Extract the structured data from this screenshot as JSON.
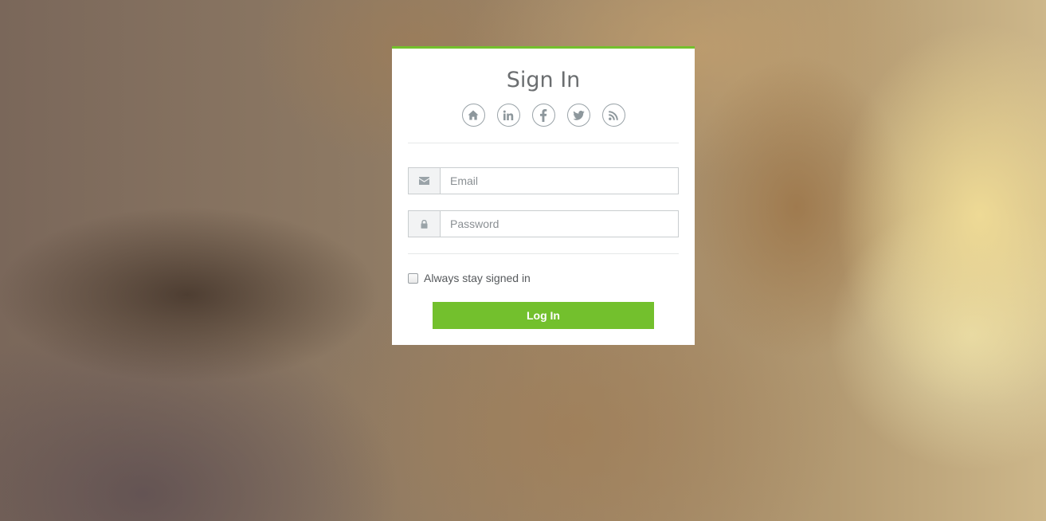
{
  "form": {
    "title": "Sign In",
    "social_icons": [
      "home-icon",
      "linkedin-icon",
      "facebook-icon",
      "twitter-icon",
      "rss-icon"
    ],
    "email": {
      "placeholder": "Email",
      "value": "",
      "icon": "envelope-icon"
    },
    "password": {
      "placeholder": "Password",
      "value": "",
      "icon": "lock-icon"
    },
    "remember_label": "Always stay signed in",
    "remember_checked": false,
    "submit_label": "Log In"
  },
  "colors": {
    "accent": "#73c02d",
    "icon_gray": "#8d979c",
    "title_text": "#6b6e70"
  }
}
